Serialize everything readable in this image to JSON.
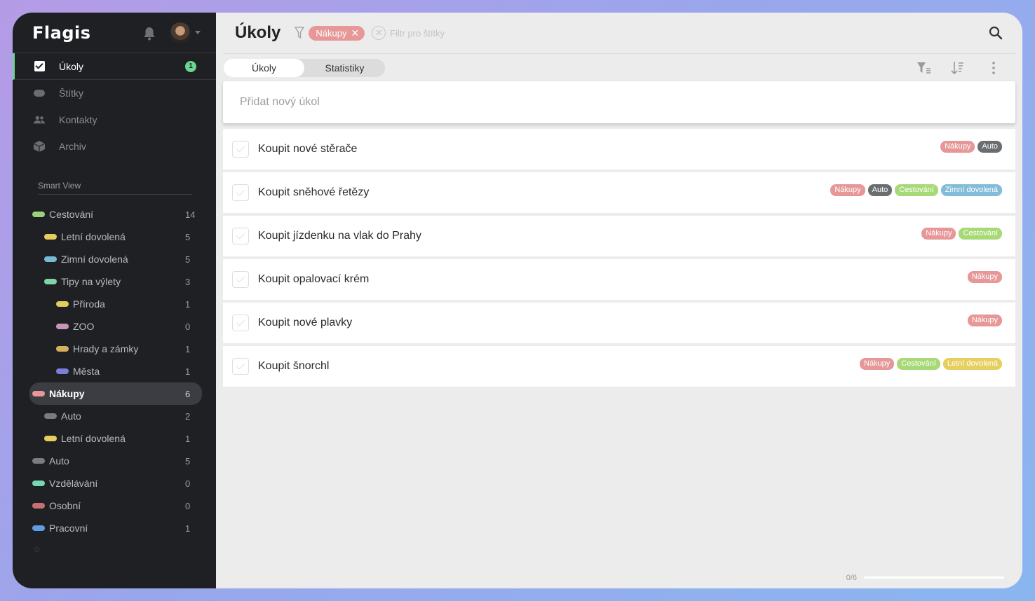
{
  "app": {
    "logo": "Flagis"
  },
  "sidebar": {
    "nav": [
      {
        "label": "Úkoly",
        "badge": "1",
        "active": true,
        "icon": "checkbox-icon"
      },
      {
        "label": "Štítky",
        "icon": "tag-icon"
      },
      {
        "label": "Kontakty",
        "icon": "people-icon"
      },
      {
        "label": "Archiv",
        "icon": "archive-box-icon"
      }
    ],
    "smart_view_title": "Smart View",
    "tree": [
      {
        "label": "Cestování",
        "count": "14",
        "color": "#9ad27a",
        "level": 0
      },
      {
        "label": "Letní dovolená",
        "count": "5",
        "color": "#e7cd5e",
        "level": 1
      },
      {
        "label": "Zimní dovolená",
        "count": "5",
        "color": "#7ab9d8",
        "level": 1
      },
      {
        "label": "Tipy na výlety",
        "count": "3",
        "color": "#7fd3a4",
        "level": 1
      },
      {
        "label": "Příroda",
        "count": "1",
        "color": "#e2cc5c",
        "level": 2
      },
      {
        "label": "ZOO",
        "count": "0",
        "color": "#c994b8",
        "level": 2
      },
      {
        "label": "Hrady a zámky",
        "count": "1",
        "color": "#d6b061",
        "level": 2
      },
      {
        "label": "Města",
        "count": "1",
        "color": "#7d7ed8",
        "level": 2
      },
      {
        "label": "Nákupy",
        "count": "6",
        "color": "#e79797",
        "level": 0,
        "selected": true
      },
      {
        "label": "Auto",
        "count": "2",
        "color": "#7a7d80",
        "level": 1
      },
      {
        "label": "Letní dovolená",
        "count": "1",
        "color": "#e7cd5e",
        "level": 1
      },
      {
        "label": "Auto",
        "count": "5",
        "color": "#7a7d80",
        "level": 0
      },
      {
        "label": "Vzdělávání",
        "count": "0",
        "color": "#79d7b0",
        "level": 0
      },
      {
        "label": "Osobní",
        "count": "0",
        "color": "#c86f6f",
        "level": 0
      },
      {
        "label": "Pracovní",
        "count": "1",
        "color": "#5f9de0",
        "level": 0
      }
    ]
  },
  "header": {
    "title": "Úkoly",
    "active_filter": "Nákupy",
    "filter_placeholder": "Filtr pro štítky"
  },
  "tabs": [
    {
      "label": "Úkoly",
      "active": true
    },
    {
      "label": "Statistiky"
    }
  ],
  "add_task": {
    "placeholder": "Přidat nový úkol"
  },
  "tag_colors": {
    "Nákupy": "#e79797",
    "Auto": "#6b6e71",
    "Cestování": "#a8d977",
    "Zimní dovolená": "#82bcd9",
    "Letní dovolená": "#e6cf5f"
  },
  "tasks": [
    {
      "title": "Koupit nové stěrače",
      "tags": [
        "Nákupy",
        "Auto"
      ]
    },
    {
      "title": "Koupit sněhové řetězy",
      "tags": [
        "Nákupy",
        "Auto",
        "Cestování",
        "Zimní dovolená"
      ]
    },
    {
      "title": "Koupit jízdenku na vlak do Prahy",
      "tags": [
        "Nákupy",
        "Cestování"
      ]
    },
    {
      "title": "Koupit opalovací krém",
      "tags": [
        "Nákupy"
      ]
    },
    {
      "title": "Koupit nové plavky",
      "tags": [
        "Nákupy"
      ]
    },
    {
      "title": "Koupit šnorchl",
      "tags": [
        "Nákupy",
        "Cestování",
        "Letní dovolená"
      ]
    }
  ],
  "footer": {
    "progress_text": "0/6",
    "progress_fraction": 0
  }
}
